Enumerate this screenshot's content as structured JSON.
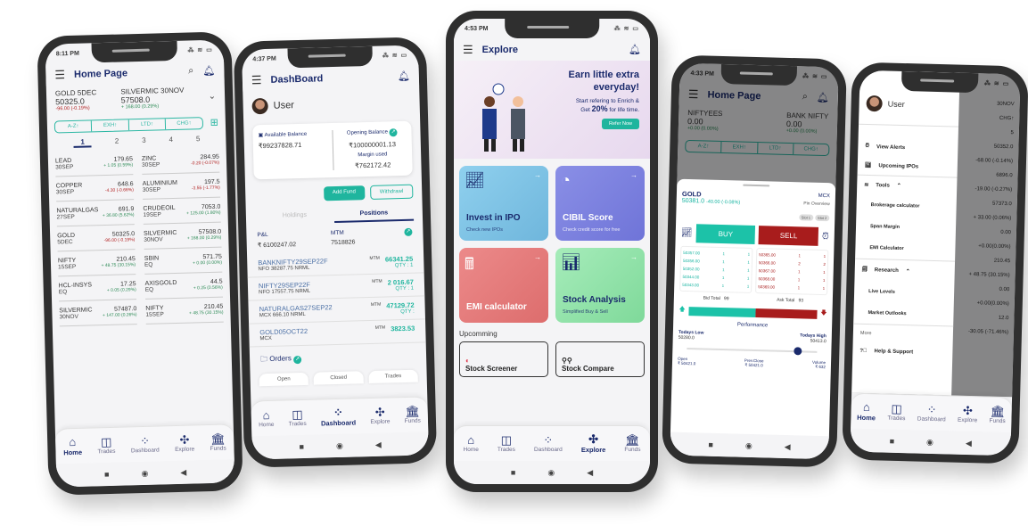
{
  "phone1": {
    "time": "8:11 PM",
    "title": "Home Page",
    "tickers": [
      {
        "name": "GOLD 5DEC",
        "price": "50325.0",
        "change": "-96.00 (-0.19%)",
        "dir": "down"
      },
      {
        "name": "SILVERMIC 30NOV",
        "price": "57508.0",
        "change": "+ 168.00 (0.29%)",
        "dir": "up"
      }
    ],
    "sort": [
      "A-Z↑",
      "EXH↑",
      "LTD↑",
      "CHG↑"
    ],
    "pages": [
      "1",
      "2",
      "3",
      "4",
      "5"
    ],
    "watchlist": [
      {
        "sym": "LEAD",
        "exp": "30SEP",
        "price": "179.65",
        "chg": "+ 1.05 (0.59%)",
        "dir": "up"
      },
      {
        "sym": "ZINC",
        "exp": "30SEP",
        "price": "284.95",
        "chg": "-0.20 (-0.07%)",
        "dir": "down"
      },
      {
        "sym": "COPPER",
        "exp": "30SEP",
        "price": "648.6",
        "chg": "-4.30 (-0.66%)",
        "dir": "down"
      },
      {
        "sym": "ALUMINIUM",
        "exp": "30SEP",
        "price": "197.5",
        "chg": "-3.55 (-1.77%)",
        "dir": "down"
      },
      {
        "sym": "NATURALGAS",
        "exp": "27SEP",
        "price": "691.9",
        "chg": "+ 36.80 (5.62%)",
        "dir": "up"
      },
      {
        "sym": "CRUDEOIL",
        "exp": "19SEP",
        "price": "7053.0",
        "chg": "+ 125.00 (1.80%)",
        "dir": "up"
      },
      {
        "sym": "GOLD",
        "exp": "5DEC",
        "price": "50325.0",
        "chg": "-96.00 (-0.19%)",
        "dir": "down"
      },
      {
        "sym": "SILVERMIC",
        "exp": "30NOV",
        "price": "57508.0",
        "chg": "+ 168.00 (0.29%)",
        "dir": "up"
      },
      {
        "sym": "NIFTY",
        "exp": "15SEP",
        "price": "210.45",
        "chg": "+ 48.75 (30.15%)",
        "dir": "up"
      },
      {
        "sym": "SBIN",
        "exp": "EQ",
        "price": "571.75",
        "chg": "+ 0.00 (0.00%)",
        "dir": "up"
      },
      {
        "sym": "HCL-INSYS",
        "exp": "EQ",
        "price": "17.25",
        "chg": "+ 0.05 (0.29%)",
        "dir": "up"
      },
      {
        "sym": "AXISGOLD",
        "exp": "EQ",
        "price": "44.5",
        "chg": "+ 0.25 (0.56%)",
        "dir": "up"
      },
      {
        "sym": "SILVERMIC",
        "exp": "30NOV",
        "price": "57487.0",
        "chg": "+ 147.00 (0.26%)",
        "dir": "up"
      },
      {
        "sym": "NIFTY",
        "exp": "15SEP",
        "price": "210.45",
        "chg": "+ 48.75 (30.15%)",
        "dir": "up"
      }
    ]
  },
  "nav": {
    "home": "Home",
    "trades": "Trades",
    "dashboard": "Dashboard",
    "explore": "Explore",
    "funds": "Funds"
  },
  "phone2": {
    "time": "4:37 PM",
    "title": "DashBoard",
    "user": "User",
    "available_label": "Available Balance",
    "available": "₹99237828.71",
    "opening_label": "Opening Balance",
    "opening": "₹100000001.13",
    "margin_label": "Margin used",
    "margin": "₹762172.42",
    "add_fund": "Add Fund",
    "withdraw": "Withdrawl",
    "tabs": [
      "Holdings",
      "Positions"
    ],
    "pl_label": "P&L",
    "pl": "₹ 6100247.02",
    "mtm_label": "MTM",
    "mtm": "7518826",
    "positions": [
      {
        "sym": "BANKNIFTY29SEP22F",
        "info": "NFO 38287.75 NRML",
        "mtm": "66341.25",
        "qty": "QTY : 1"
      },
      {
        "sym": "NIFTY29SEP22F",
        "info": "NFO 17557.75 NRML",
        "mtm": "2 016.67",
        "qty": "QTY : 1"
      },
      {
        "sym": "NATURALGAS27SEP22",
        "info": "MCX 666.10 NRML",
        "mtm": "47129.72",
        "qty": "QTY :"
      },
      {
        "sym": "GOLD05OCT22",
        "info": "MCX",
        "mtm": "3823.53",
        "qty": ""
      }
    ],
    "mtm_tag": "MTM",
    "orders": "Orders",
    "order_tabs": [
      "Open",
      "Closed",
      "Trades"
    ]
  },
  "phone3": {
    "time": "4:53 PM",
    "title": "Explore",
    "banner_h": "Earn little extra everyday!",
    "banner_s1": "Start refering to Enrich &",
    "banner_s2a": "Get",
    "banner_pct": "20%",
    "banner_s2b": "for life time.",
    "refer": "Refer Now",
    "cards": [
      {
        "title": "Invest in IPO",
        "sub": "Check new IPOs",
        "color": "#7ec4e6"
      },
      {
        "title": "CIBIL Score",
        "sub": "Check credit score for free",
        "color": "#7d84e0"
      },
      {
        "title": "EMI calculator",
        "sub": "",
        "color": "#e27a7a"
      },
      {
        "title": "Stock Analysis",
        "sub": "Simplified Buy & Sell",
        "color": "#8fe0a4"
      }
    ],
    "upcoming": "Upcomming",
    "up_cards": [
      "Stock Screener",
      "Stock Compare"
    ]
  },
  "phone4": {
    "time": "4:33 PM",
    "title": "Home Page",
    "tickers": [
      {
        "name": "NIFTYEES",
        "price": "0.00",
        "change": "+0.00 (0.00%)"
      },
      {
        "name": "BANK NIFTY",
        "price": "0.00",
        "change": "+0.00 (0.00%)"
      }
    ],
    "sym": "GOLD",
    "exch": "MCX",
    "ltp": "50381.0",
    "chg": "-40.00 (-0.08%)",
    "pin": "Pin Overview",
    "slots": [
      "Slot 1",
      "Slot 2"
    ],
    "buy": "BUY",
    "sell": "SELL",
    "bids": [
      [
        "50357.00",
        "1",
        "1"
      ],
      [
        "50356.00",
        "1",
        "1"
      ],
      [
        "50352.00",
        "1",
        "1"
      ],
      [
        "50344.00",
        "1",
        "1"
      ],
      [
        "50343.00",
        "1",
        "1"
      ]
    ],
    "asks": [
      [
        "50365.00",
        "1",
        "1"
      ],
      [
        "50366.00",
        "2",
        "2"
      ],
      [
        "50367.00",
        "1",
        "1"
      ],
      [
        "50368.00",
        "1",
        "1"
      ],
      [
        "50369.00",
        "1",
        "1"
      ]
    ],
    "bid_total_label": "Bid Total",
    "bid_total": "99",
    "ask_total_label": "Ask Total",
    "ask_total": "93",
    "buy_share": 0.52,
    "performance": "Performance",
    "low_label": "Todays Low",
    "low": "50280.0",
    "high_label": "Todays High",
    "high": "50413.0",
    "range_pos": 0.85,
    "open_label": "Open",
    "open": "₹ 50421.0",
    "prev_label": "Prev.Close",
    "prev": "₹ 50421.0",
    "vol_label": "Volume",
    "vol": "₹ 632"
  },
  "phone5": {
    "time": "4:40 PM",
    "user": "User",
    "items": [
      "View Alerts",
      "Upcoming IPOs",
      "Tools"
    ],
    "tools": [
      "Brokerage calculator",
      "Span Margin",
      "EMI Calculator"
    ],
    "research": "Research",
    "research_items": [
      "Live Levels",
      "Market Outlooks"
    ],
    "more": "More",
    "help": "Help & Support",
    "bg": [
      "30NOV",
      "CHG↑",
      "5",
      "50352.0",
      "-68.00 (-0.14%)",
      "6896.0",
      "-19.00 (-0.27%)",
      "57373.0",
      "+ 33.00 (0.06%)",
      "0.00",
      "+0.00(0.00%)",
      "210.45",
      "+ 48.75 (30.15%)",
      "0.00",
      "+0.00(0.00%)",
      "12.0",
      "-30.05 (-71.46%)"
    ]
  }
}
